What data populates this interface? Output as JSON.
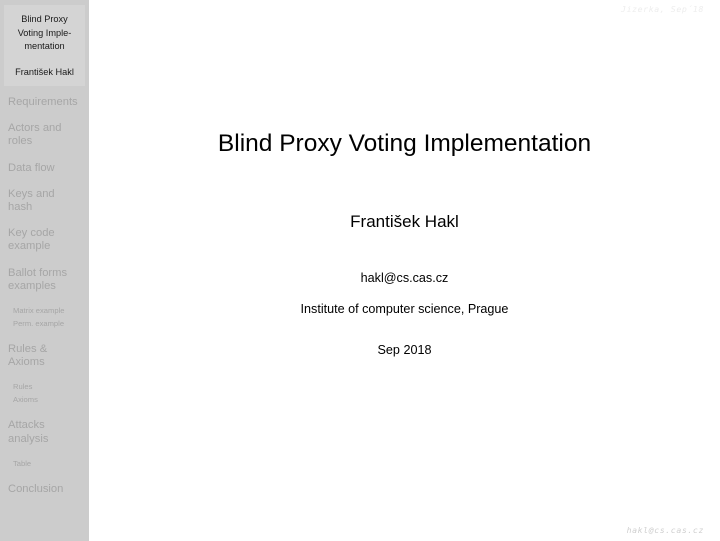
{
  "colors": {
    "sidebar_bg": "#cccccc",
    "sidebar_title_block_bg": "#d4d4d4",
    "sidebar_text": "#a6a6a6",
    "sidebar_title_text": "#1a1a1a",
    "body_bg": "#ffffff",
    "body_text": "#000000",
    "headline_text": "#ededed",
    "footline_text": "#cfcfcf"
  },
  "headline": {
    "text": "Jizerka, Sep´18"
  },
  "footline": {
    "text": "hakl@cs.cas.cz"
  },
  "sidebar": {
    "deck_title": "Blind Proxy\nVoting Imple-\nmentation",
    "author": "František Hakl",
    "toc": [
      {
        "label": "Requirements",
        "level": "section"
      },
      {
        "label": "Actors and\nroles",
        "level": "section"
      },
      {
        "label": "Data flow",
        "level": "section"
      },
      {
        "label": "Keys and\nhash",
        "level": "section"
      },
      {
        "label": "Key code\nexample",
        "level": "section"
      },
      {
        "label": "Ballot forms\nexamples",
        "level": "section"
      },
      {
        "label": "Matrix example",
        "level": "subsection"
      },
      {
        "label": "Perm. example",
        "level": "subsection",
        "last": true
      },
      {
        "label": "Rules &\nAxioms",
        "level": "section"
      },
      {
        "label": "Rules",
        "level": "subsection"
      },
      {
        "label": "Axioms",
        "level": "subsection",
        "last": true
      },
      {
        "label": "Attacks\nanalysis",
        "level": "section"
      },
      {
        "label": "Table",
        "level": "subsection",
        "last": true
      },
      {
        "label": "Conclusion",
        "level": "section"
      }
    ]
  },
  "main": {
    "title": "Blind Proxy Voting Implementation",
    "author": "František Hakl",
    "email": "hakl@cs.cas.cz",
    "institute": "Institute of computer science, Prague",
    "date": "Sep 2018"
  }
}
